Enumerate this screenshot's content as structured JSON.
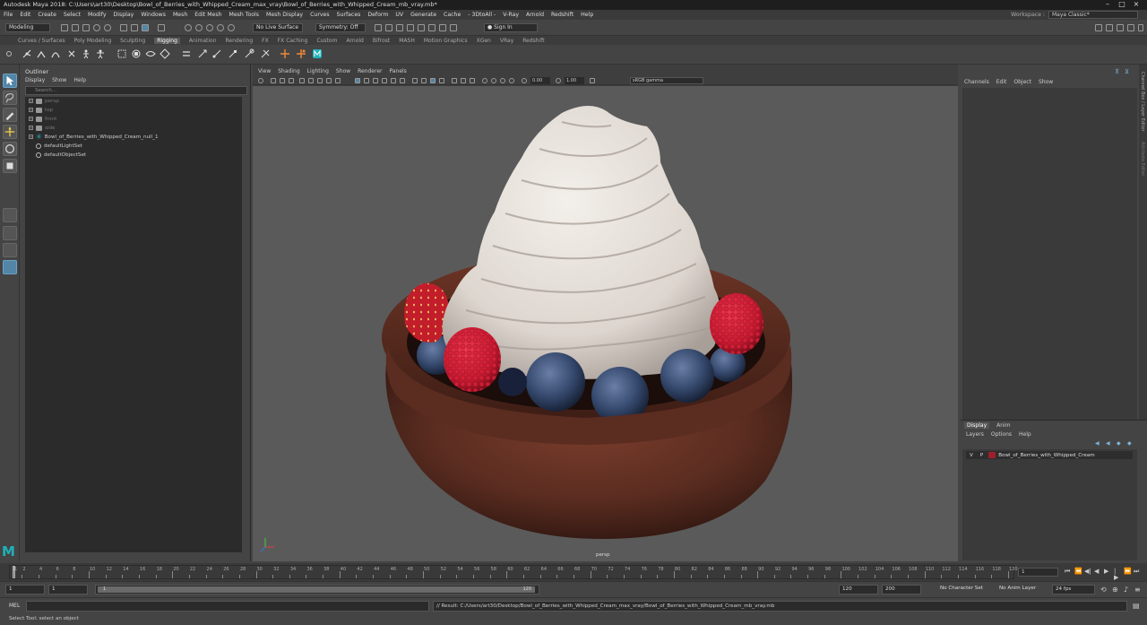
{
  "window": {
    "title": "Autodesk Maya 2018: C:\\Users\\art30\\Desktop\\Bowl_of_Berries_with_Whipped_Cream_max_vray\\Bowl_of_Berries_with_Whipped_Cream_mb_vray.mb*"
  },
  "menubar": {
    "items": [
      "File",
      "Edit",
      "Create",
      "Select",
      "Modify",
      "Display",
      "Windows",
      "Mesh",
      "Edit Mesh",
      "Mesh Tools",
      "Mesh Display",
      "Curves",
      "Surfaces",
      "Deform",
      "UV",
      "Generate",
      "Cache",
      "- 3DtoAll -",
      "V-Ray",
      "Arnold",
      "Redshift",
      "Help"
    ],
    "workspace_label": "Workspace :",
    "workspace_value": "Maya Classic*"
  },
  "statusline": {
    "mode": "Modeling",
    "live_surface": "No Live Surface",
    "symmetry": "Symmetry: Off",
    "sign_in": "Sign In"
  },
  "shelf_tabs": [
    "Curves / Surfaces",
    "Poly Modeling",
    "Sculpting",
    "Rigging",
    "Animation",
    "Rendering",
    "FX",
    "FX Caching",
    "Custom",
    "Arnold",
    "Bifrost",
    "MASH",
    "Motion Graphics",
    "XGen",
    "VRay",
    "Redshift"
  ],
  "shelf_active_tab": "Rigging",
  "outliner": {
    "title": "Outliner",
    "menu": [
      "Display",
      "Show",
      "Help"
    ],
    "search_placeholder": "Search...",
    "items": [
      {
        "label": "persp",
        "type": "camera"
      },
      {
        "label": "top",
        "type": "camera"
      },
      {
        "label": "front",
        "type": "camera"
      },
      {
        "label": "side",
        "type": "camera"
      },
      {
        "label": "Bowl_of_Berries_with_Whipped_Cream_null_1",
        "type": "null"
      },
      {
        "label": "defaultLightSet",
        "type": "set"
      },
      {
        "label": "defaultObjectSet",
        "type": "set"
      }
    ]
  },
  "viewport": {
    "menu": [
      "View",
      "Shading",
      "Lighting",
      "Show",
      "Renderer",
      "Panels"
    ],
    "exposure": "0.00",
    "gamma": "1.00",
    "color_space": "sRGB gamma",
    "camera_label": "persp"
  },
  "channelbox": {
    "menu": [
      "Channels",
      "Edit",
      "Object",
      "Show"
    ],
    "side_tabs": [
      "Channel Box / Layer Editor",
      "Attribute Editor"
    ]
  },
  "layer_editor": {
    "tabs": [
      "Display",
      "Anim"
    ],
    "menu": [
      "Layers",
      "Options",
      "Help"
    ],
    "layer": {
      "v": "V",
      "p": "P",
      "name": "Bowl_of_Berries_with_Whipped_Cream",
      "color": "#a01e2c"
    }
  },
  "timeslider": {
    "ticks": [
      "1",
      "2",
      "4",
      "6",
      "8",
      "10",
      "12",
      "14",
      "16",
      "18",
      "20",
      "22",
      "24",
      "26",
      "28",
      "30",
      "32",
      "34",
      "36",
      "38",
      "40",
      "42",
      "44",
      "46",
      "48",
      "50",
      "52",
      "54",
      "56",
      "58",
      "60",
      "62",
      "64",
      "66",
      "68",
      "70",
      "72",
      "74",
      "76",
      "78",
      "80",
      "82",
      "84",
      "86",
      "88",
      "90",
      "92",
      "94",
      "96",
      "98",
      "100",
      "102",
      "104",
      "106",
      "108",
      "110",
      "112",
      "114",
      "116",
      "118",
      "120"
    ],
    "current_frame": "1"
  },
  "rangeslider": {
    "start": "1",
    "start_inner": "1",
    "range_start_label": "1",
    "range_end_label": "120",
    "end_inner": "120",
    "end": "200",
    "character_set": "No Character Set",
    "anim_layer": "No Anim Layer",
    "fps": "24 fps"
  },
  "cmdline": {
    "label": "MEL",
    "result": "// Result: C:/Users/art30/Desktop/Bowl_of_Berries_with_Whipped_Cream_max_vray/Bowl_of_Berries_with_Whipped_Cream_mb_vray.mb"
  },
  "helpline": "Select Tool: select an object",
  "colors": {
    "accent": "#5285a6",
    "maya_logo": "#1fb1ba",
    "bowl": "#5a2e22",
    "cream": "#e6e0da",
    "blueberry": "#2c3a55",
    "raspberry": "#c2182e"
  }
}
